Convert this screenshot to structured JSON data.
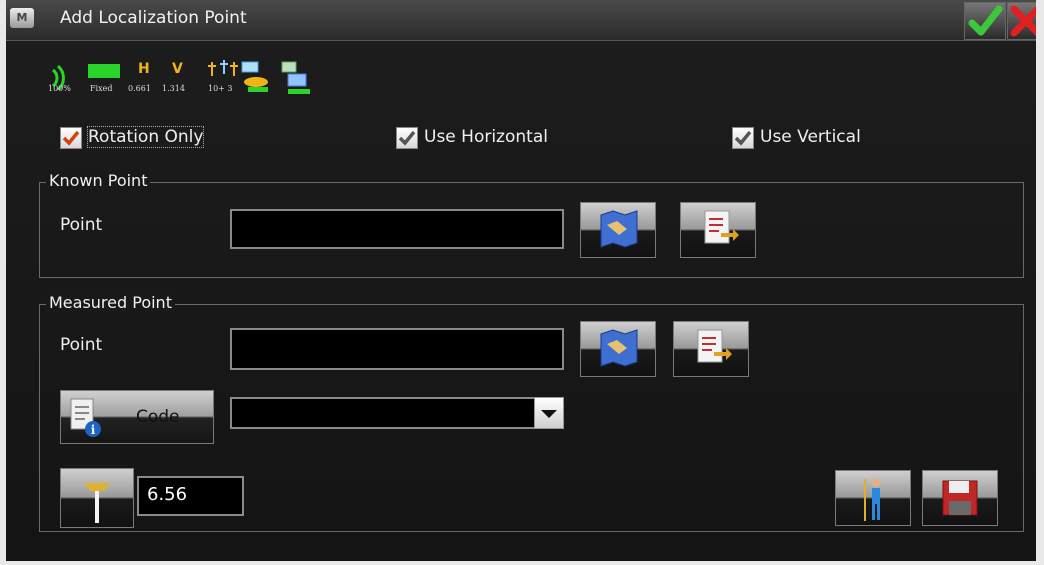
{
  "window": {
    "title": "Add Localization Point",
    "app_icon_letter": "M"
  },
  "status": {
    "signal_percent": "100%",
    "fix_label": "Fixed",
    "h_label": "H",
    "h_value": "0.661",
    "v_label": "V",
    "v_value": "1.314",
    "satellites": "10+ 3",
    "colors": {
      "fix_bar": "#2bd42b",
      "h_v_letters": "#f0b418"
    }
  },
  "options": {
    "rotation_only": {
      "label": "Rotation Only",
      "checked": true
    },
    "use_horizontal": {
      "label": "Use Horizontal",
      "checked": true
    },
    "use_vertical": {
      "label": "Use Vertical",
      "checked": true
    }
  },
  "known_point": {
    "group_title": "Known Point",
    "point_label": "Point",
    "point_value": ""
  },
  "measured_point": {
    "group_title": "Measured Point",
    "point_label": "Point",
    "point_value": "",
    "code_button_label": "Code",
    "code_value": "",
    "antenna_height": "6.56"
  },
  "icons": {
    "ok": "check-icon",
    "cancel": "close-icon",
    "map": "map-icon",
    "list": "point-list-icon",
    "code": "document-info-icon",
    "antenna": "rod-height-icon",
    "measure": "surveyor-icon",
    "save": "save-icon"
  }
}
